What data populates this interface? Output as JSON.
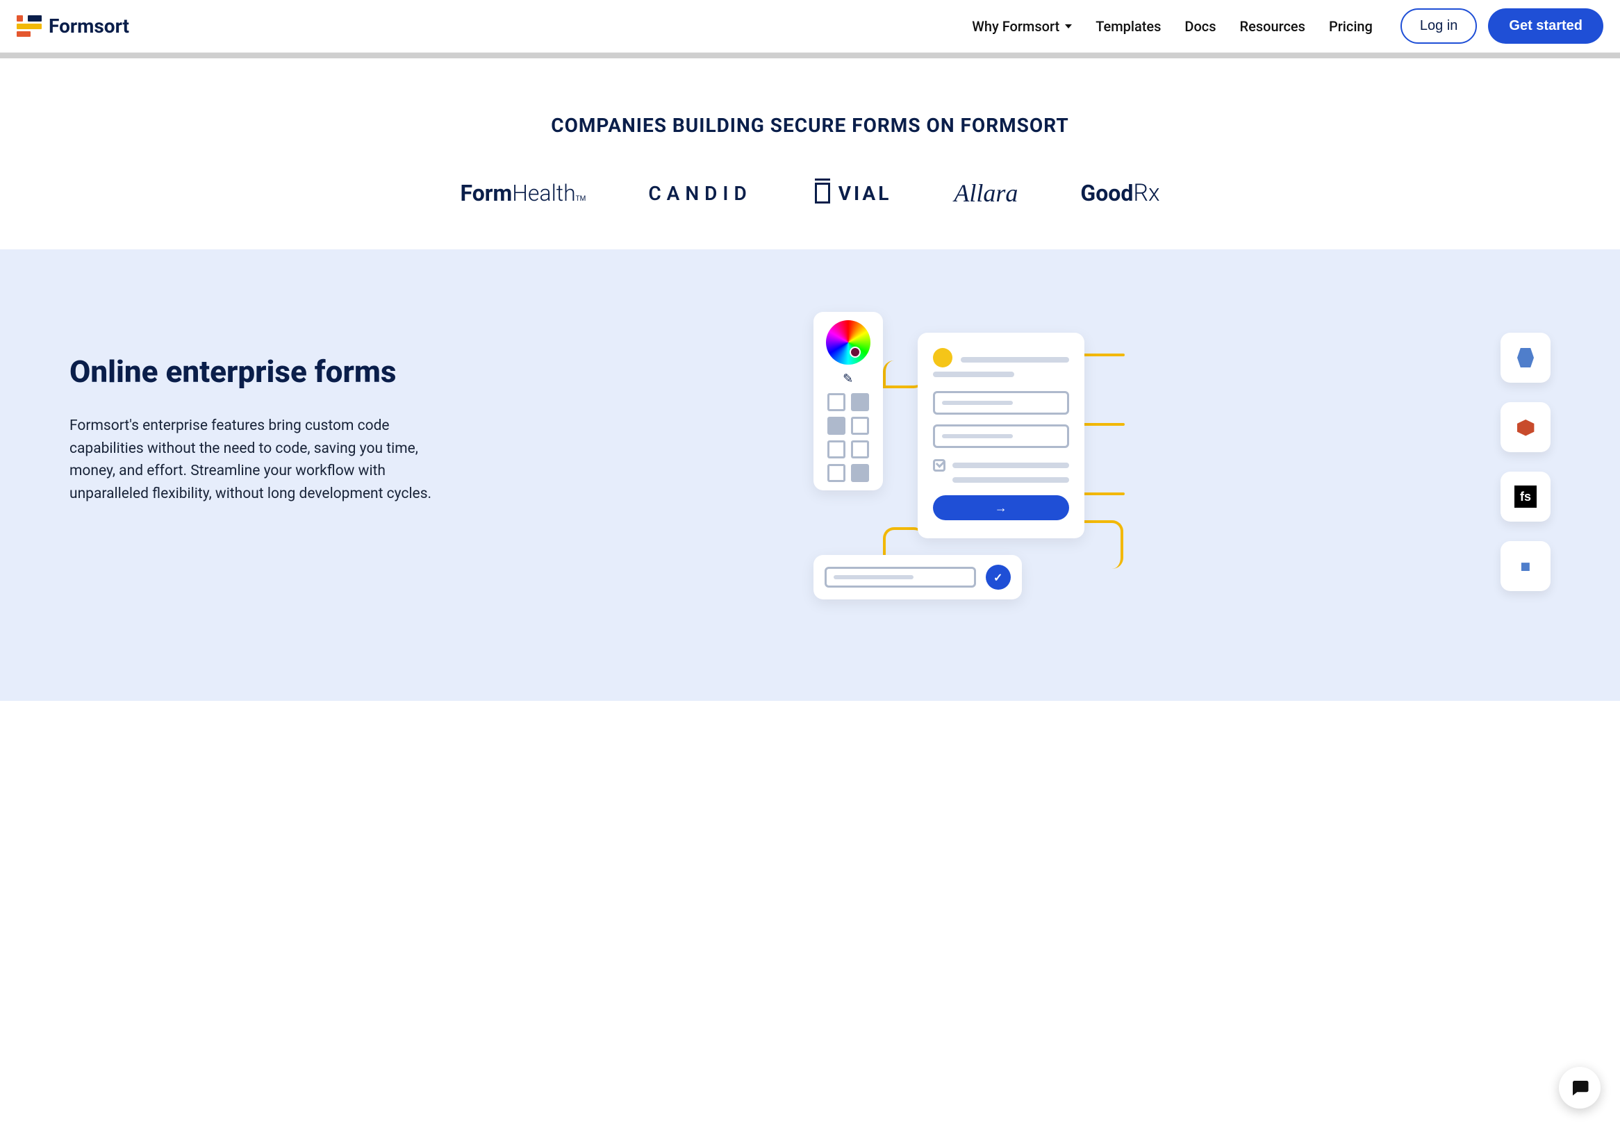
{
  "brand": "Formsort",
  "nav": {
    "why": "Why Formsort",
    "templates": "Templates",
    "docs": "Docs",
    "resources": "Resources",
    "pricing": "Pricing"
  },
  "auth": {
    "login": "Log in",
    "cta": "Get started"
  },
  "companies": {
    "title": "COMPANIES BUILDING SECURE FORMS ON FORMSORT",
    "logos": {
      "formhealth_a": "Form",
      "formhealth_b": "Health",
      "formhealth_tm": "TM",
      "candid": "CANDID",
      "vial": "VIAL",
      "allara": "Allara",
      "goodrx_a": "Good",
      "goodrx_b": "Rx"
    }
  },
  "feature": {
    "title": "Online enterprise forms",
    "body": "Formsort's enterprise features bring custom code capabilities without the need to code, saving you time, money, and effort. Streamline your workflow with unparalleled flexibility, without long development cycles."
  },
  "illustration": {
    "tile3_text": "fs",
    "arrow_glyph": "→",
    "check_glyph": "✓",
    "dropper_glyph": "✎",
    "diamond_glyph": "◆",
    "hex_glyph": "⬢"
  }
}
